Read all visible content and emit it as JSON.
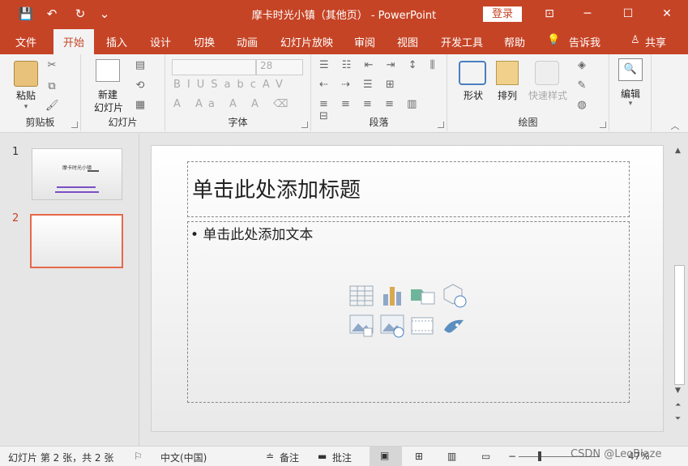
{
  "window": {
    "title": "摩卡时光小镇（其他页） - PowerPoint",
    "signin": "登录"
  },
  "qat": {
    "save": "💾",
    "undo": "↶",
    "redo": "↻",
    "customize": "⌄"
  },
  "wincontrols": {
    "ribbon": "⊡",
    "min": "─",
    "max": "☐",
    "close": "✕"
  },
  "tabs": [
    "文件",
    "开始",
    "插入",
    "设计",
    "切换",
    "动画",
    "幻灯片放映",
    "审阅",
    "视图",
    "开发工具",
    "帮助"
  ],
  "tellme": "告诉我",
  "share": "共享",
  "ribbon": {
    "clipboard": {
      "label": "剪贴板",
      "paste": "粘贴"
    },
    "slides": {
      "label": "幻灯片",
      "new_line1": "新建",
      "new_line2": "幻灯片"
    },
    "font": {
      "label": "字体",
      "size": "28"
    },
    "paragraph": {
      "label": "段落"
    },
    "drawing": {
      "label": "绘图",
      "shape": "形状",
      "arrange": "排列",
      "quickstyle": "快速样式"
    },
    "editing": {
      "label": "编辑"
    }
  },
  "thumbnails": [
    {
      "number": "1",
      "title": "摩卡时光小镇"
    },
    {
      "number": "2"
    }
  ],
  "slide": {
    "title_placeholder": "单击此处添加标题",
    "body_placeholder": "• 单击此处添加文本"
  },
  "status": {
    "slide_info": "幻灯片 第 2 张，共 2 张",
    "language": "中文(中国)",
    "notes": "备注",
    "comments": "批注",
    "zoom": "47%",
    "watermark": "CSDN @LeoBlaze"
  }
}
